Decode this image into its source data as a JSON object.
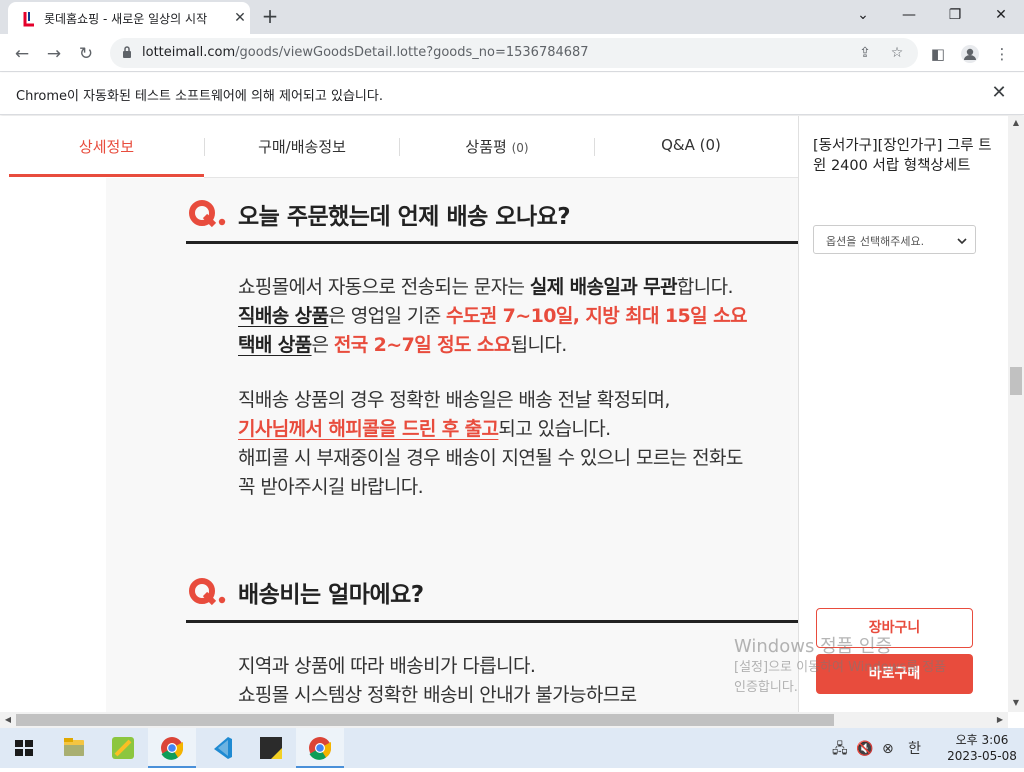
{
  "browser": {
    "tab_title": "롯데홈쇼핑 - 새로운 일상의 시작",
    "tab_close": "✕",
    "new_tab": "+",
    "url_host": "lotteimall.com",
    "url_path": "/goods/viewGoodsDetail.lotte?goods_no=1536784687",
    "infobar_text": "Chrome이 자동화된 테스트 소프트웨어에 의해 제어되고 있습니다.",
    "infobar_close": "✕"
  },
  "page_tabs": [
    {
      "label": "상세정보",
      "count": ""
    },
    {
      "label": "구매/배송정보",
      "count": ""
    },
    {
      "label": "상품평",
      "count": "(0)"
    },
    {
      "label": "Q&A (0)",
      "count": ""
    }
  ],
  "content": {
    "q1_title": "오늘 주문했는데 언제 배송 오나요?",
    "q1_p1_l1_a": "쇼핑몰에서 자동으로 전송되는 문자는 ",
    "q1_p1_l1_b": "실제 배송일과 무관",
    "q1_p1_l1_c": "합니다.",
    "q1_p1_l2_a": "직배송 상품",
    "q1_p1_l2_b": "은 영업일 기준 ",
    "q1_p1_l2_c": "수도권 7~10일, 지방 최대 15일 소요",
    "q1_p1_l3_a": "택배 상품",
    "q1_p1_l3_b": "은 ",
    "q1_p1_l3_c": "전국 2~7일 정도 소요",
    "q1_p1_l3_d": "됩니다.",
    "q1_p2_l1": "직배송 상품의 경우 정확한 배송일은 배송 전날 확정되며,",
    "q1_p2_l2_a": "기사님께서 해피콜을 드린 후 출고",
    "q1_p2_l2_b": "되고 있습니다.",
    "q1_p2_l3": "해피콜 시 부재중이실 경우 배송이 지연될 수 있으니 모르는 전화도",
    "q1_p2_l4": "꼭 받아주시길 바랍니다.",
    "q2_title": "배송비는 얼마에요?",
    "q2_l1": "지역과 상품에 따라 배송비가 다릅니다.",
    "q2_l2": "쇼핑몰 시스템상 정확한 배송비 안내가 불가능하므로"
  },
  "sidebar": {
    "product_name": "[동서가구][장인가구] 그루 트윈 2400 서랍 형책상세트",
    "option_placeholder": "옵션을 선택해주세요.",
    "cart_label": "장바구니",
    "buy_label": "바로구매"
  },
  "watermark": {
    "line1": "Windows 정품 인증",
    "line2": "[설정]으로 이동하여 Windows를 정품",
    "line3": "인증합니다."
  },
  "taskbar": {
    "time": "오후 3:06",
    "date": "2023-05-08",
    "ime": "한"
  },
  "colors": {
    "accent": "#e84c3d",
    "chrome_tabstrip": "#dee1e6"
  }
}
